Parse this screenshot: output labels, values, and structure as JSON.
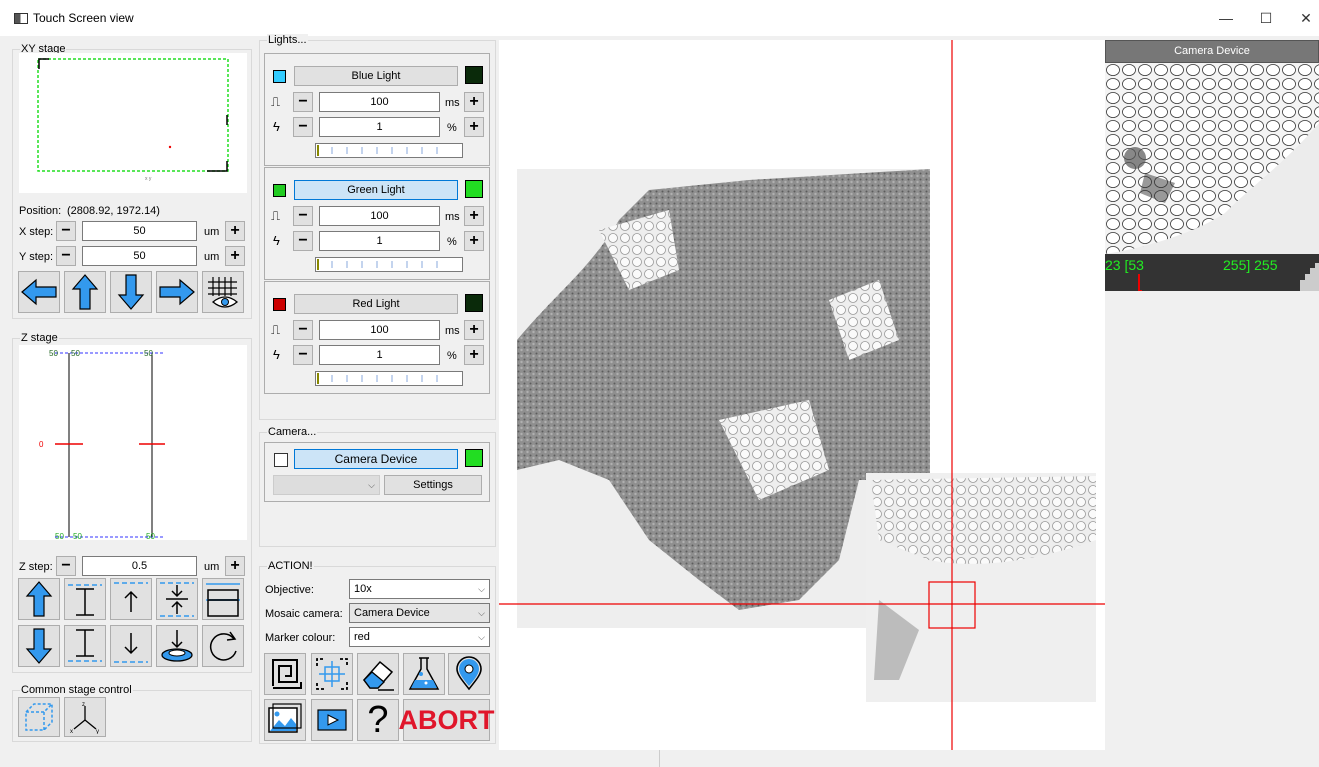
{
  "window": {
    "title": "Touch Screen view",
    "minimize": "—",
    "maximize": "☐",
    "close": "✕"
  },
  "xy_stage": {
    "title": "XY stage",
    "position_label": "Position:",
    "position_value": "(2808.92, 1972.14)",
    "x_step_label": "X step:",
    "x_step_value": "50",
    "x_unit": "um",
    "y_step_label": "Y step:",
    "y_step_value": "50",
    "y_unit": "um",
    "minus": "−",
    "plus": "+"
  },
  "z_stage": {
    "title": "Z stage",
    "top_labels": [
      "50",
      "50",
      "50"
    ],
    "mid_label": "0",
    "bottom_labels": [
      "50",
      "50",
      "50"
    ],
    "z_step_label": "Z step:",
    "z_step_value": "0.5",
    "z_unit": "um"
  },
  "common": {
    "title": "Common stage control"
  },
  "lights": {
    "title": "Lights...",
    "items": [
      {
        "name": "Blue Light",
        "exposure": "100",
        "exposure_unit": "ms",
        "power": "1",
        "power_unit": "%",
        "swatch": "#33ccff",
        "indicator": "#0a2a0a",
        "active": false
      },
      {
        "name": "Green Light",
        "exposure": "100",
        "exposure_unit": "ms",
        "power": "1",
        "power_unit": "%",
        "swatch": "#22cc22",
        "indicator": "#22dd22",
        "active": true
      },
      {
        "name": "Red Light",
        "exposure": "100",
        "exposure_unit": "ms",
        "power": "1",
        "power_unit": "%",
        "swatch": "#cc0000",
        "indicator": "#0a2a0a",
        "active": false
      }
    ]
  },
  "camera": {
    "title": "Camera...",
    "device": "Camera Device",
    "settings": "Settings",
    "select_value": ""
  },
  "action": {
    "title": "ACTION!",
    "objective_label": "Objective:",
    "objective_value": "10x",
    "mosaic_label": "Mosaic camera:",
    "mosaic_value": "Camera Device",
    "marker_label": "Marker colour:",
    "marker_value": "red",
    "abort": "ABORT",
    "help": "?"
  },
  "camera_preview": {
    "header": "Camera Device",
    "hist_left": "23 [53",
    "hist_right": "255] 255"
  }
}
